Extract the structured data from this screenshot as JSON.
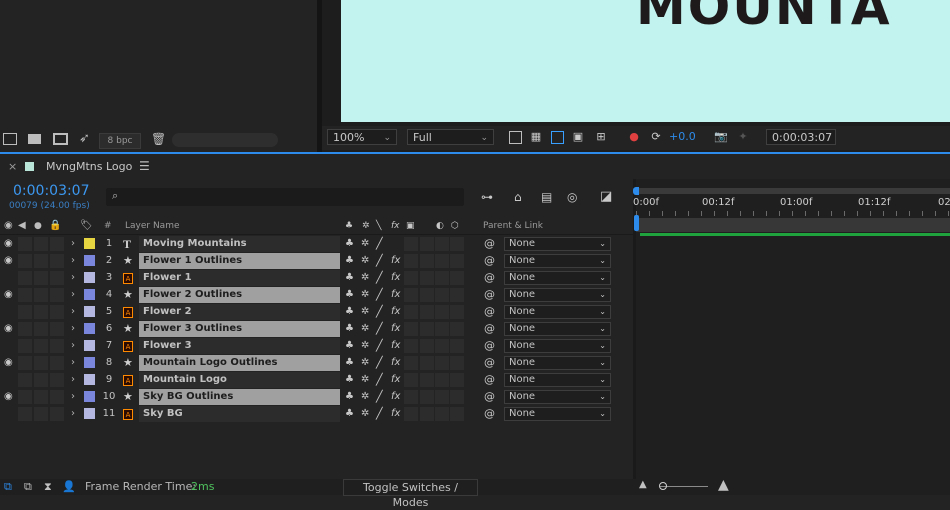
{
  "colors": {
    "accent": "#2d8ceb",
    "canvas": "#c2f3ee",
    "green": "#1fa33d"
  },
  "project": {
    "bpc": "8 bpc"
  },
  "viewer": {
    "comp_text": "MOUNTA",
    "zoom": "100%",
    "resolution": "Full",
    "exposure": "+0.0",
    "timecode": "0:00:03:07"
  },
  "timeline": {
    "tab_title": "MvngMtns Logo",
    "current_time": "0:00:03:07",
    "frame_info": "00079 (24.00 fps)",
    "search_placeholder": "",
    "ruler": [
      "0:00f",
      "00:12f",
      "01:00f",
      "01:12f",
      "02"
    ],
    "columns": {
      "hash": "#",
      "layer_name": "Layer Name",
      "parent_link": "Parent & Link"
    },
    "layers": [
      {
        "num": "1",
        "name": "Moving Mountains",
        "type": "text",
        "label_color": "#e6d540",
        "selected": false,
        "visible": true,
        "bar_color": "#8a8240",
        "parent": "None"
      },
      {
        "num": "2",
        "name": "Flower 1 Outlines",
        "type": "shape",
        "label_color": "#7a86dc",
        "selected": true,
        "visible": true,
        "bar_color": "#4e63c4",
        "parent": "None"
      },
      {
        "num": "3",
        "name": "Flower 1",
        "type": "ai",
        "label_color": "#b4b7e0",
        "selected": false,
        "visible": false,
        "bar_color": "#6a6a78",
        "parent": "None"
      },
      {
        "num": "4",
        "name": "Flower 2 Outlines",
        "type": "shape",
        "label_color": "#7a86dc",
        "selected": true,
        "visible": true,
        "bar_color": "#4e63c4",
        "parent": "None"
      },
      {
        "num": "5",
        "name": "Flower 2",
        "type": "ai",
        "label_color": "#b4b7e0",
        "selected": false,
        "visible": false,
        "bar_color": "#6a6a78",
        "parent": "None"
      },
      {
        "num": "6",
        "name": "Flower 3 Outlines",
        "type": "shape",
        "label_color": "#7a86dc",
        "selected": true,
        "visible": true,
        "bar_color": "#4e63c4",
        "parent": "None"
      },
      {
        "num": "7",
        "name": "Flower 3",
        "type": "ai",
        "label_color": "#b4b7e0",
        "selected": false,
        "visible": false,
        "bar_color": "#6a6a78",
        "parent": "None"
      },
      {
        "num": "8",
        "name": "Mountain Logo Outlines",
        "type": "shape",
        "label_color": "#7a86dc",
        "selected": true,
        "visible": true,
        "bar_color": "#4e63c4",
        "parent": "None"
      },
      {
        "num": "9",
        "name": "Mountain Logo",
        "type": "ai",
        "label_color": "#b4b7e0",
        "selected": false,
        "visible": false,
        "bar_color": "#6a6a78",
        "parent": "None"
      },
      {
        "num": "10",
        "name": "Sky BG Outlines",
        "type": "shape",
        "label_color": "#7a86dc",
        "selected": true,
        "visible": true,
        "bar_color": "#4e63c4",
        "parent": "None"
      },
      {
        "num": "11",
        "name": "Sky BG",
        "type": "ai",
        "label_color": "#b4b7e0",
        "selected": false,
        "visible": false,
        "bar_color": "#6a6a78",
        "parent": "None"
      }
    ]
  },
  "footer": {
    "render_label": "Frame Render Time:",
    "render_value": "2ms",
    "toggle": "Toggle Switches / Modes"
  }
}
